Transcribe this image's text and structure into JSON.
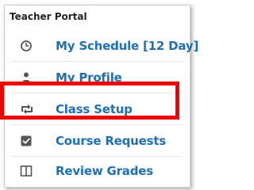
{
  "portal": {
    "title": "Teacher Portal",
    "items": [
      {
        "label": "My Schedule [12 Day]",
        "icon": "clock-icon"
      },
      {
        "label": "My Profile",
        "icon": "person-icon"
      },
      {
        "label": "Class Setup",
        "icon": "retweet-icon"
      },
      {
        "label": "Course Requests",
        "icon": "checkbox-icon"
      },
      {
        "label": "Review Grades",
        "icon": "columns-icon"
      }
    ]
  },
  "colors": {
    "link": "#1f6fb5",
    "highlight": "#ee0000",
    "icon": "#555555"
  }
}
